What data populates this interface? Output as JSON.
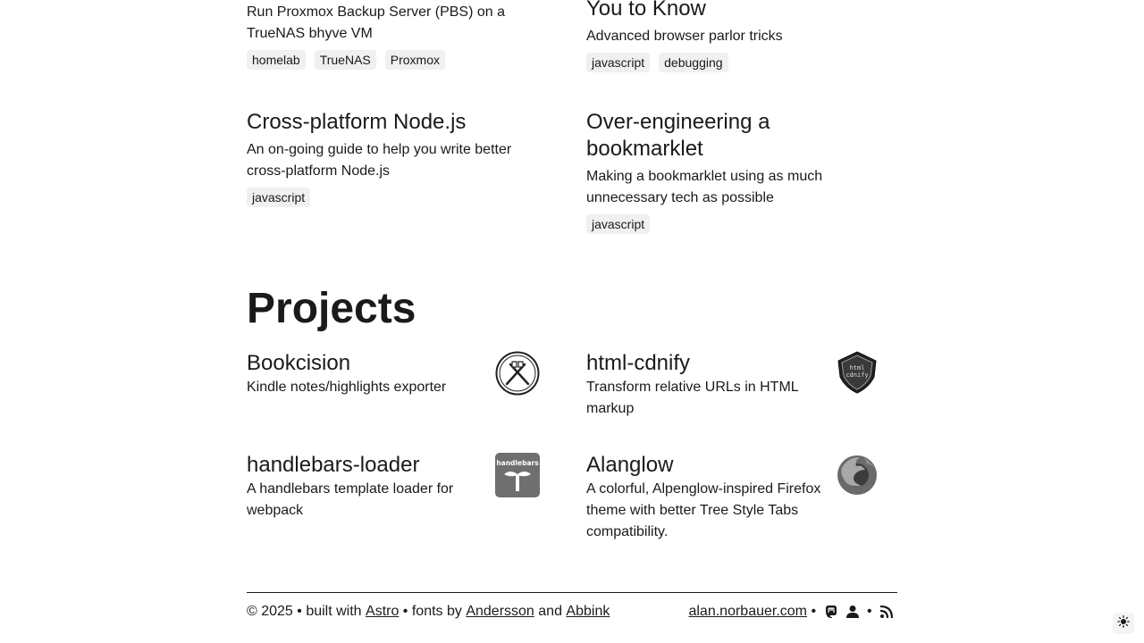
{
  "posts": [
    {
      "title": "",
      "description": "Run Proxmox Backup Server (PBS) on a TrueNAS bhyve VM",
      "tags": [
        "homelab",
        "TrueNAS",
        "Proxmox"
      ]
    },
    {
      "title": "You to Know",
      "description": "Advanced browser parlor tricks",
      "tags": [
        "javascript",
        "debugging"
      ]
    },
    {
      "title": "Cross-platform Node.js",
      "description": "An on-going guide to help you write better cross-platform Node.js",
      "tags": [
        "javascript"
      ]
    },
    {
      "title": "Over-engineering a bookmarklet",
      "description": "Making a bookmarklet using as much unnecessary tech as possible",
      "tags": [
        "javascript"
      ]
    }
  ],
  "projects_heading": "Projects",
  "projects": [
    {
      "title": "Bookcision",
      "description": "Kindle notes/highlights exporter",
      "logo_icon": "bookcision-logo-icon"
    },
    {
      "title": "html-cdnify",
      "description": "Transform relative URLs in HTML markup",
      "logo_icon": "html-cdnify-shield-logo-icon",
      "logo_text_1": "html",
      "logo_text_2": "cdnify"
    },
    {
      "title": "handlebars-loader",
      "description": "A handlebars template loader for webpack",
      "logo_icon": "handlebars-logo-icon",
      "logo_text": "handlebars"
    },
    {
      "title": "Alanglow",
      "description": "A colorful, Alpenglow-inspired Firefox theme with better Tree Style Tabs compatibility.",
      "logo_icon": "firefox-logo-icon"
    }
  ],
  "footer": {
    "copyright": "© 2025 • built with ",
    "astro": "Astro",
    "fonts_by": " • fonts by ",
    "andersson": "Andersson",
    "and": " and ",
    "abbink": "Abbink",
    "site": "alan.norbauer.com",
    "bullet": " • ",
    "icons": [
      "mastodon-icon",
      "person-icon",
      "rss-icon"
    ]
  },
  "theme_toggle_icon": "sun-icon",
  "colors": {
    "text": "#1a1a1a",
    "tag_bg": "#f0f0f0",
    "background": "#ffffff"
  }
}
